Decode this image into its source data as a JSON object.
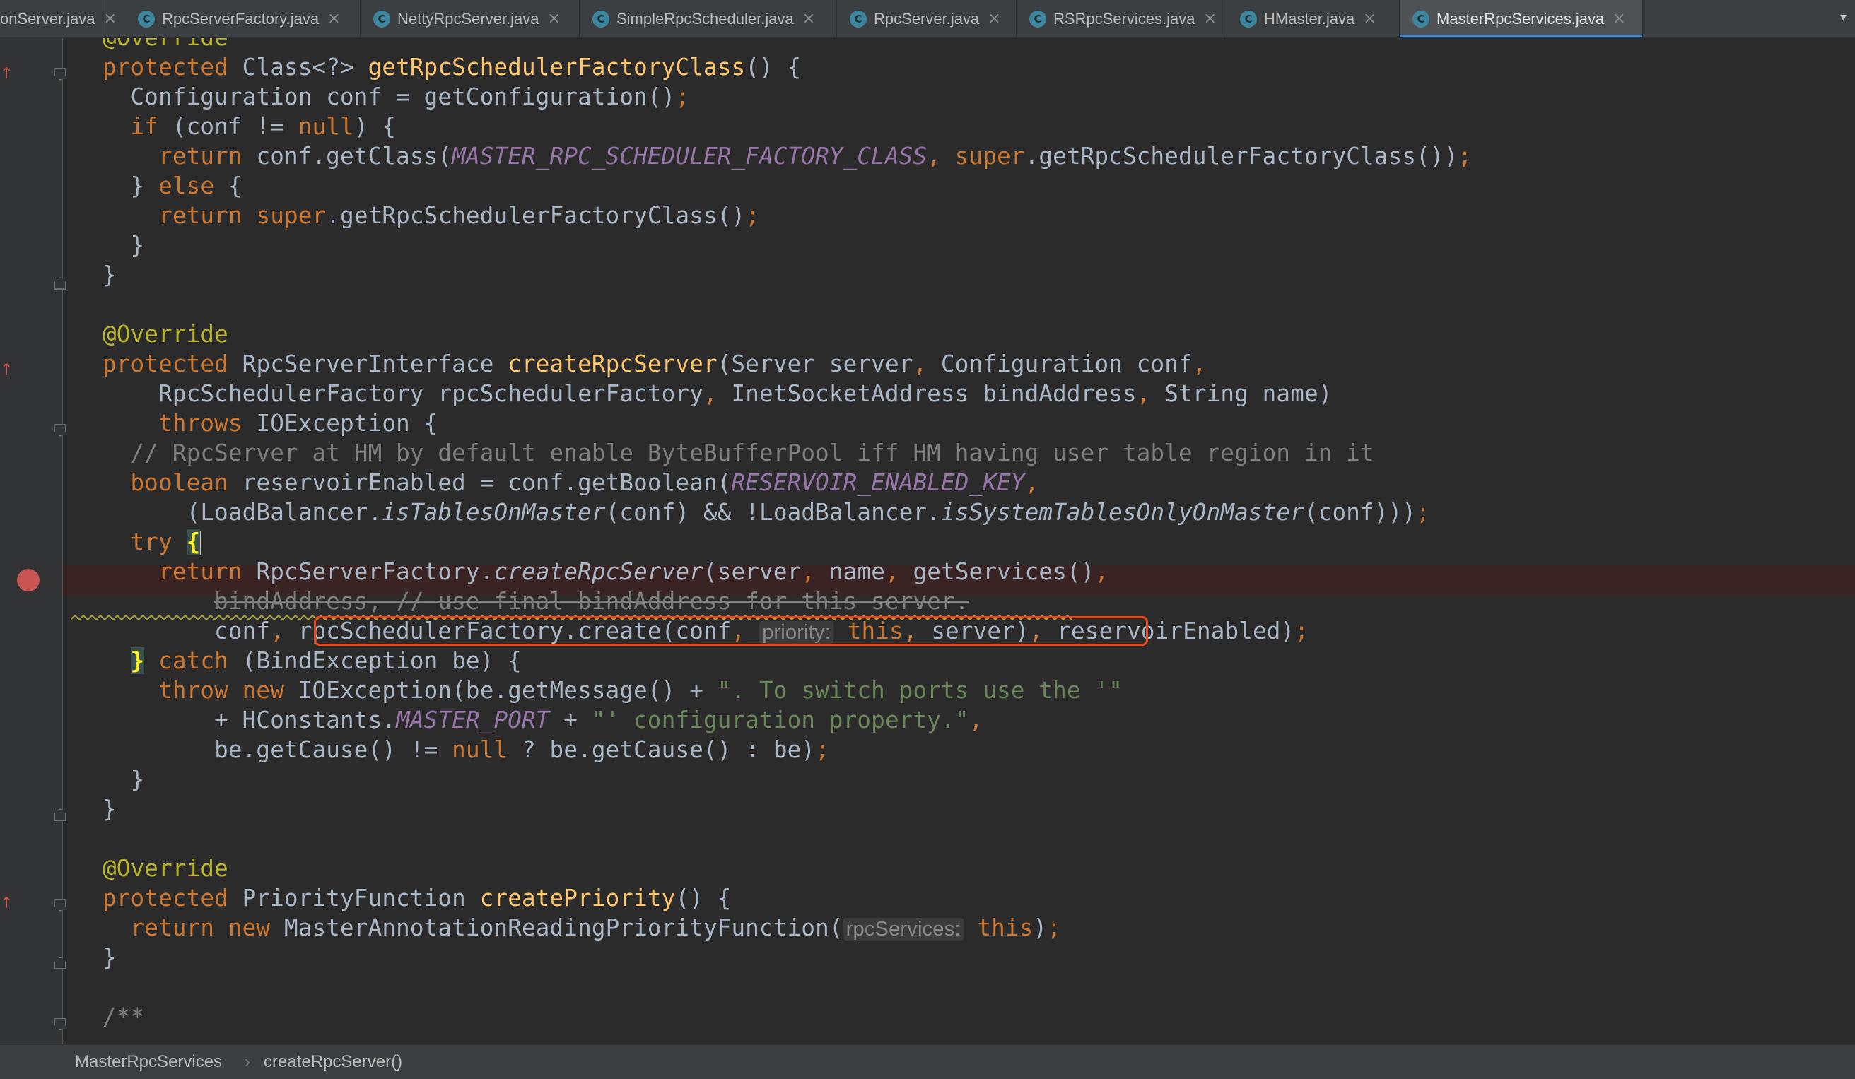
{
  "tabs": [
    {
      "label": "onServer.java",
      "icon": "",
      "active": false
    },
    {
      "label": "RpcServerFactory.java",
      "icon": "C",
      "active": false
    },
    {
      "label": "NettyRpcServer.java",
      "icon": "C",
      "active": false
    },
    {
      "label": "SimpleRpcScheduler.java",
      "icon": "C",
      "active": false
    },
    {
      "label": "RpcServer.java",
      "icon": "C",
      "active": false
    },
    {
      "label": "RSRpcServices.java",
      "icon": "C",
      "active": false
    },
    {
      "label": "HMaster.java",
      "icon": "C",
      "active": false
    },
    {
      "label": "MasterRpcServices.java",
      "icon": "C",
      "active": true
    }
  ],
  "tab_close": "×",
  "tab_overflow": "▾",
  "code": {
    "l0_ann": "@Override",
    "l1_kw": "protected",
    "l1_a": " Class<?> ",
    "l1_fn": "getRpcSchedulerFactoryClass",
    "l1_b": "() {",
    "l2_a": "  Configuration conf = getConfiguration()",
    "l2_semi": ";",
    "l3_kw": "  if",
    "l3_a": " (conf != ",
    "l3_null": "null",
    "l3_b": ") {",
    "l4_kw": "    return",
    "l4_a": " conf.getClass(",
    "l4_cst": "MASTER_RPC_SCHEDULER_FACTORY_CLASS",
    "l4_comma": ", ",
    "l4_super": "super",
    "l4_b": ".getRpcSchedulerFactoryClass())",
    "l4_semi": ";",
    "l5_a": "  } ",
    "l5_kw": "else",
    "l5_b": " {",
    "l6_kw": "    return",
    "l6_sp": " ",
    "l6_super": "super",
    "l6_a": ".getRpcSchedulerFactoryClass()",
    "l6_semi": ";",
    "l7": "  }",
    "l8": "}",
    "l10_ann": "@Override",
    "l11_kw": "protected",
    "l11_a": " RpcServerInterface ",
    "l11_fn": "createRpcServer",
    "l11_b": "(Server server",
    "l11_c1": ",",
    "l11_c": " Configuration conf",
    "l11_c2": ",",
    "l12_a": "    RpcSchedulerFactory rpcSchedulerFactory",
    "l12_c1": ",",
    "l12_b": " InetSocketAddress bindAddress",
    "l12_c2": ",",
    "l12_c": " String name)",
    "l13_kw": "    throws",
    "l13_a": " IOException {",
    "l14_cmt": "  // RpcServer at HM by default enable ByteBufferPool iff HM having user table region in it",
    "l15_kw": "  boolean",
    "l15_a": " reservoirEnabled = conf.getBoolean(",
    "l15_cst": "RESERVOIR_ENABLED_KEY",
    "l15_comma": ",",
    "l16_a": "      (LoadBalancer.",
    "l16_i1": "isTablesOnMaster",
    "l16_b": "(conf) && !LoadBalancer.",
    "l16_i2": "isSystemTablesOnlyOnMaster",
    "l16_c": "(conf)))",
    "l16_semi": ";",
    "l17_kw": "  try",
    "l17_sp": " ",
    "l17_brace": "{",
    "l18_kw": "    return",
    "l18_a": " RpcServerFactory.",
    "l18_i": "createRpcServer",
    "l18_b": "(server",
    "l18_c1": ",",
    "l18_c": " name",
    "l18_c2": ",",
    "l18_d": " getServices()",
    "l18_c3": ",",
    "l19_ind": "        ",
    "l19_strike": "bindAddress, // use final bindAddress for this server.",
    "l20_a": "        conf",
    "l20_c1": ",",
    "l20_b": " rpcSchedulerFactory.create(conf",
    "l20_c2": ",",
    "l20_sp": " ",
    "l20_hint": "priority:",
    "l20_this": " this",
    "l20_c3": ",",
    "l20_d": " server)",
    "l20_c4": ",",
    "l20_e": " reservoirEnabled)",
    "l20_semi": ";",
    "l21_brace": "}",
    "l21_kw": " catch",
    "l21_a": " (BindException be) {",
    "l22_kw": "    throw new",
    "l22_a": " IOException(be.getMessage() + ",
    "l22_str": "\". To switch ports use the '\"",
    "l23_a": "        + HConstants.",
    "l23_cst": "MASTER_PORT",
    "l23_b": " + ",
    "l23_str": "\"' configuration property.\"",
    "l23_comma": ",",
    "l24_a": "        be.getCause() != ",
    "l24_null": "null",
    "l24_b": " ? be.getCause() : be)",
    "l24_semi": ";",
    "l25": "  }",
    "l26": "}",
    "l28_ann": "@Override",
    "l29_kw": "protected",
    "l29_a": " PriorityFunction ",
    "l29_fn": "createPriority",
    "l29_b": "() {",
    "l30_kw": "  return new",
    "l30_a": " MasterAnnotationReadingPriorityFunction(",
    "l30_hint": "rpcServices:",
    "l30_this": " this",
    "l30_b": ")",
    "l30_semi": ";",
    "l31": "}",
    "l33_cmt": "/**"
  },
  "gutter": {
    "override_icon": "↑",
    "breakpoint": "breakpoint"
  },
  "breadcrumb": {
    "class": "MasterRpcServices",
    "sep": "›",
    "method": "createRpcServer()"
  },
  "colors": {
    "keyword": "#cc7832",
    "annotation": "#bbb529",
    "method": "#ffc66d",
    "constant": "#9876aa",
    "string": "#6a8759",
    "comment": "#808080",
    "highlight_box": "#e8481e",
    "breakpoint": "#c75450",
    "active_tab_underline": "#4a88c7"
  }
}
